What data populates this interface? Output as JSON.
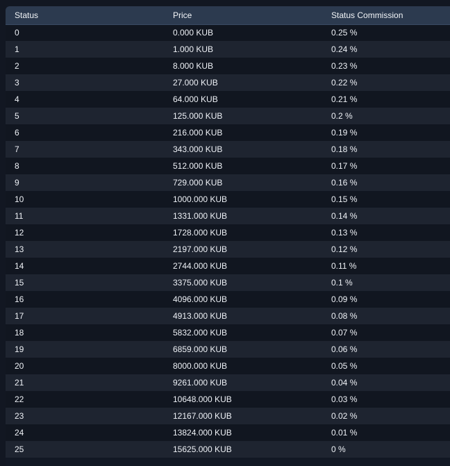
{
  "table": {
    "headers": [
      "Status",
      "Price",
      "Status Commission"
    ],
    "rows": [
      [
        "0",
        "0.000 KUB",
        "0.25 %"
      ],
      [
        "1",
        "1.000 KUB",
        "0.24 %"
      ],
      [
        "2",
        "8.000 KUB",
        "0.23 %"
      ],
      [
        "3",
        "27.000 KUB",
        "0.22 %"
      ],
      [
        "4",
        "64.000 KUB",
        "0.21 %"
      ],
      [
        "5",
        "125.000 KUB",
        "0.2 %"
      ],
      [
        "6",
        "216.000 KUB",
        "0.19 %"
      ],
      [
        "7",
        "343.000 KUB",
        "0.18 %"
      ],
      [
        "8",
        "512.000 KUB",
        "0.17 %"
      ],
      [
        "9",
        "729.000 KUB",
        "0.16 %"
      ],
      [
        "10",
        "1000.000 KUB",
        "0.15 %"
      ],
      [
        "11",
        "1331.000 KUB",
        "0.14 %"
      ],
      [
        "12",
        "1728.000 KUB",
        "0.13 %"
      ],
      [
        "13",
        "2197.000 KUB",
        "0.12 %"
      ],
      [
        "14",
        "2744.000 KUB",
        "0.11 %"
      ],
      [
        "15",
        "3375.000 KUB",
        "0.1 %"
      ],
      [
        "16",
        "4096.000 KUB",
        "0.09 %"
      ],
      [
        "17",
        "4913.000 KUB",
        "0.08 %"
      ],
      [
        "18",
        "5832.000 KUB",
        "0.07 %"
      ],
      [
        "19",
        "6859.000 KUB",
        "0.06 %"
      ],
      [
        "20",
        "8000.000 KUB",
        "0.05 %"
      ],
      [
        "21",
        "9261.000 KUB",
        "0.04 %"
      ],
      [
        "22",
        "10648.000 KUB",
        "0.03 %"
      ],
      [
        "23",
        "12167.000 KUB",
        "0.02 %"
      ],
      [
        "24",
        "13824.000 KUB",
        "0.01 %"
      ],
      [
        "25",
        "15625.000 KUB",
        "0 %"
      ]
    ]
  }
}
